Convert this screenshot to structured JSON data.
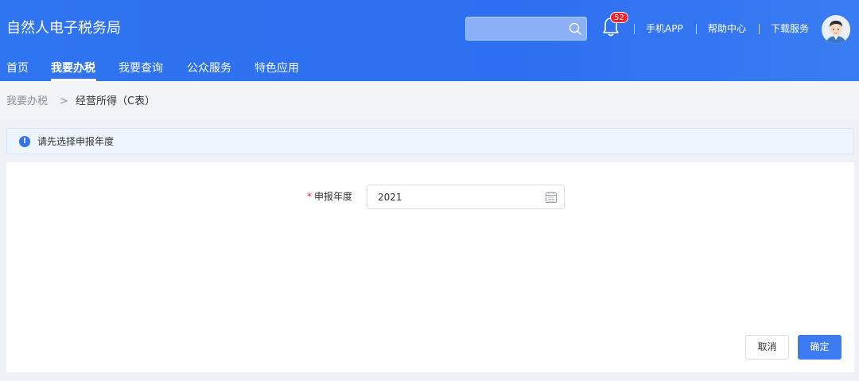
{
  "header": {
    "title": "自然人电子税务局",
    "search_placeholder": "",
    "notification_count": "52",
    "links": [
      "手机APP",
      "帮助中心",
      "下载服务"
    ]
  },
  "nav": {
    "items": [
      "首页",
      "我要办税",
      "我要查询",
      "公众服务",
      "特色应用"
    ],
    "active_index": 1
  },
  "breadcrumb": {
    "parent": "我要办税",
    "separator": ">",
    "current": "经营所得（C表）"
  },
  "alert": {
    "icon": "info-icon",
    "text": "请先选择申报年度"
  },
  "form": {
    "required_mark": "*",
    "year_label": "申报年度",
    "year_value": "2021"
  },
  "actions": {
    "cancel_label": "取消",
    "confirm_label": "确定"
  },
  "colors": {
    "header_blue": "#2f74f0",
    "primary": "#3c7cf0",
    "badge_red": "#f5222d"
  }
}
